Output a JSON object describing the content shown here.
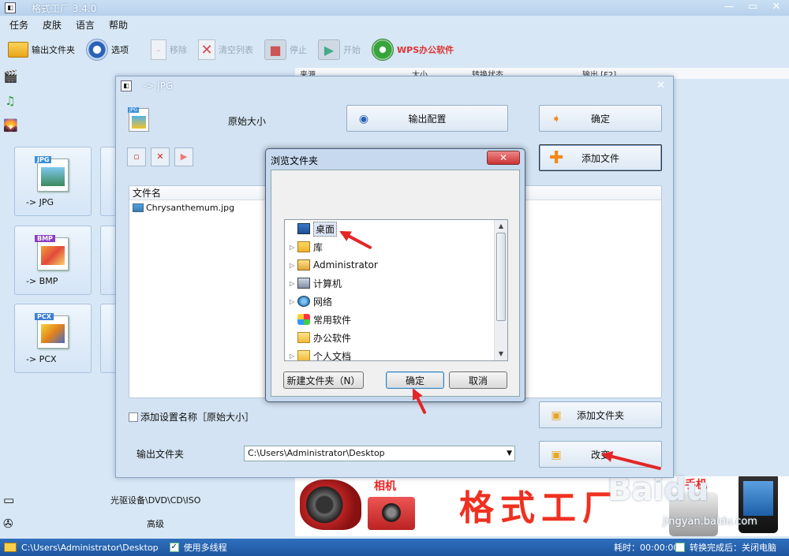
{
  "window": {
    "title": "格式工厂 3.4.0",
    "app_icon": "app-icon"
  },
  "menu": [
    "任务",
    "皮肤",
    "语言",
    "帮助"
  ],
  "toolbar": {
    "output_folder": "输出文件夹",
    "options": "选项",
    "remove": "移除",
    "clear_list": "清空列表",
    "stop": "停止",
    "start": "开始",
    "wps": "WPS办公软件"
  },
  "list_header": [
    "来源",
    "大小",
    "转换状态",
    "输出 [F2]"
  ],
  "tiles": [
    {
      "label": "-> JPG",
      "tag": "JPG",
      "tag_color": "#3b8fd4"
    },
    {
      "label": "-> BMP",
      "tag": "BMP",
      "tag_color": "#8a3ec0"
    },
    {
      "label": "-> PCX",
      "tag": "PCX",
      "tag_color": "#3b7fd4"
    }
  ],
  "bottom_nav": {
    "optical": "光驱设备\\DVD\\CD\\ISO",
    "advanced": "高级"
  },
  "banner": {
    "camera_label": "相机",
    "big_title": "格式工厂",
    "phone_label": "手机"
  },
  "watermark": {
    "sub": "jingyan.baidu.com"
  },
  "status": {
    "path": "C:\\Users\\Administrator\\Desktop",
    "multithread": "使用多线程",
    "elapsed": "耗时：00:00:00",
    "after_convert": "转换完成后：关闭电脑"
  },
  "format_dialog": {
    "title": "-> JPG",
    "size_label": "原始大小",
    "output_config": "输出配置",
    "ok": "确定",
    "add_file": "添加文件",
    "file_col": "文件名",
    "files": [
      "Chrysanthemum.jpg"
    ],
    "add_setting_name": "添加设置名称［原始大小］",
    "add_folder": "添加文件夹",
    "output_folder_label": "输出文件夹",
    "output_folder_value": "C:\\Users\\Administrator\\Desktop",
    "change": "改变"
  },
  "browse_dialog": {
    "title": "浏览文件夹",
    "tree": [
      {
        "label": "桌面",
        "icon": "desktop-icon",
        "expandable": false,
        "selected": true
      },
      {
        "label": "库",
        "icon": "library-icon",
        "expandable": true
      },
      {
        "label": "Administrator",
        "icon": "user-folder-icon",
        "expandable": true
      },
      {
        "label": "计算机",
        "icon": "computer-icon",
        "expandable": true
      },
      {
        "label": "网络",
        "icon": "network-icon",
        "expandable": true
      },
      {
        "label": "常用软件",
        "icon": "software-icon",
        "expandable": false
      },
      {
        "label": "办公软件",
        "icon": "folder-icon",
        "expandable": false
      },
      {
        "label": "个人文档",
        "icon": "folder-icon",
        "expandable": true
      }
    ],
    "new_folder": "新建文件夹（N）",
    "ok": "确定",
    "cancel": "取消"
  },
  "colors": {
    "accent": "#1e56a0",
    "annotation_arrow": "#e32626",
    "banner_title": "#f03020"
  }
}
